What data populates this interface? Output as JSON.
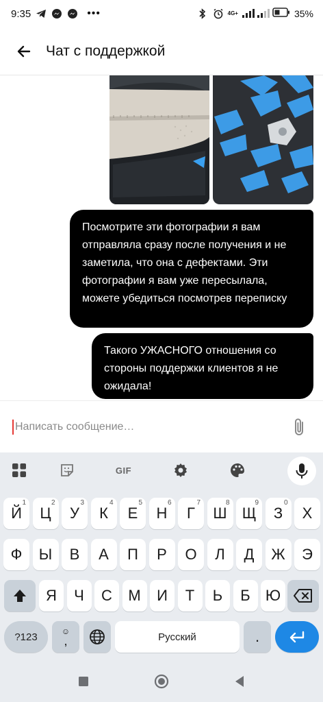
{
  "status_bar": {
    "time": "9:35",
    "network": "4G+",
    "battery_percent": "35%",
    "overflow": "•••"
  },
  "app_bar": {
    "title": "Чат с поддержкой"
  },
  "messages": [
    {
      "text": "Посмотрите эти фотографии я вам отправляла сразу после получения и не заметила, что она с дефектами. Эти фотографии я вам уже пересылала, можете убедиться посмотрев переписку"
    },
    {
      "text": "Такого УЖАСНОГО отношения со стороны поддержки клиентов я не ожидала!"
    }
  ],
  "composer": {
    "placeholder": "Написать сообщение…"
  },
  "keyboard": {
    "toolbar": {
      "gif_label": "GIF"
    },
    "row1": [
      {
        "label": "Й",
        "hint": "1"
      },
      {
        "label": "Ц",
        "hint": "2"
      },
      {
        "label": "У",
        "hint": "3"
      },
      {
        "label": "К",
        "hint": "4"
      },
      {
        "label": "Е",
        "hint": "5"
      },
      {
        "label": "Н",
        "hint": "6"
      },
      {
        "label": "Г",
        "hint": "7"
      },
      {
        "label": "Ш",
        "hint": "8"
      },
      {
        "label": "Щ",
        "hint": "9"
      },
      {
        "label": "З",
        "hint": "0"
      },
      {
        "label": "Х",
        "hint": ""
      }
    ],
    "row2": [
      "Ф",
      "Ы",
      "В",
      "А",
      "П",
      "Р",
      "О",
      "Л",
      "Д",
      "Ж",
      "Э"
    ],
    "row3": [
      "Я",
      "Ч",
      "С",
      "М",
      "И",
      "Т",
      "Ь",
      "Б",
      "Ю"
    ],
    "row4": {
      "symbols_label": "?123",
      "emoji_comma": ",",
      "space_label": "Русский",
      "period": "."
    }
  },
  "colors": {
    "bubble": "#000000",
    "accent": "#1e88e5",
    "keyboard_bg": "#e9ecf0"
  }
}
